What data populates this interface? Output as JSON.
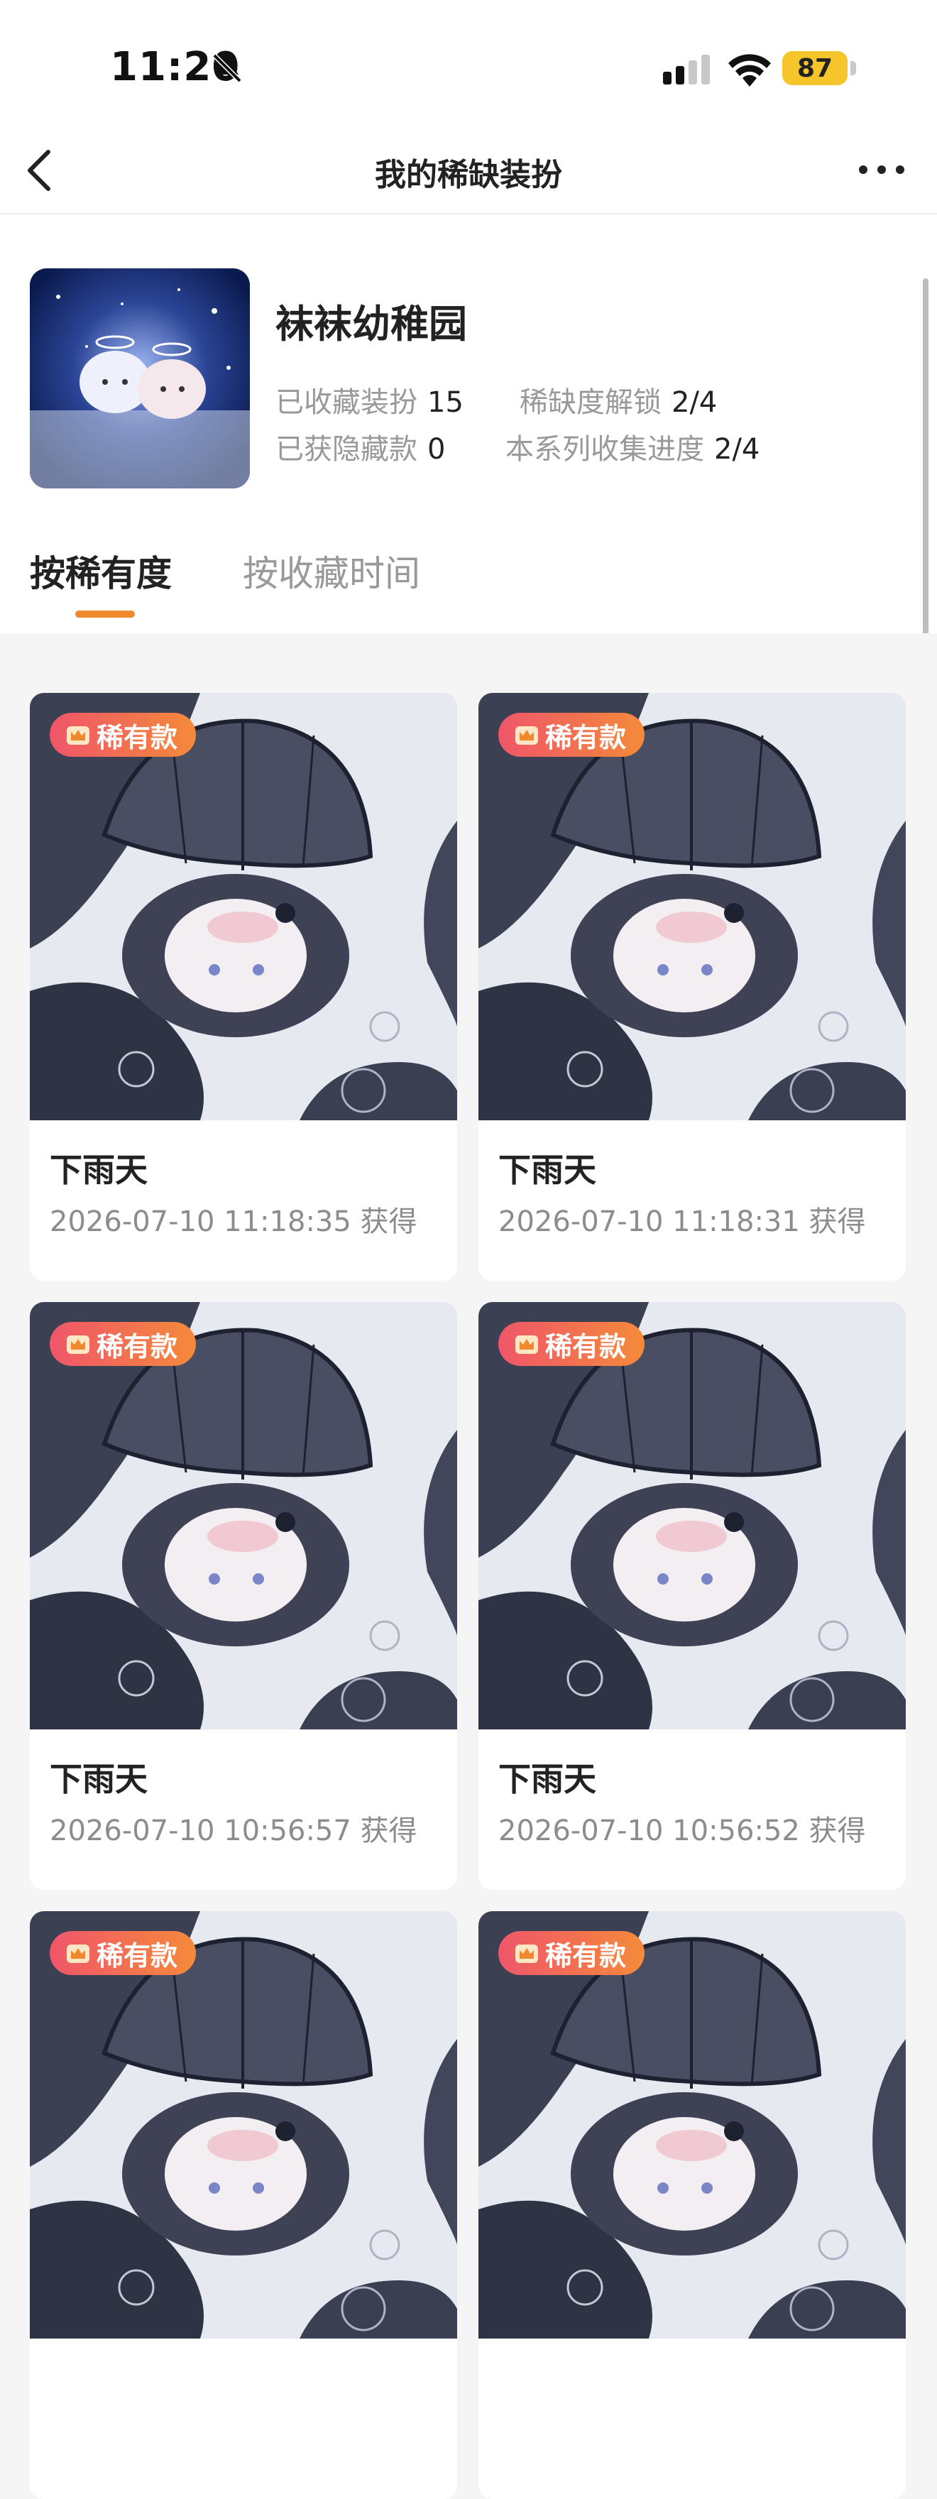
{
  "status_bar": {
    "time": "11:20",
    "battery": "87"
  },
  "nav": {
    "title": "我的稀缺装扮"
  },
  "series": {
    "title": "袜袜幼稚园",
    "stats": {
      "collected_label": "已收藏装扮",
      "collected_value": "15",
      "rarity_label": "稀缺度解锁",
      "rarity_value": "2/4",
      "hidden_label": "已获隐藏款",
      "hidden_value": "0",
      "progress_label": "本系列收集进度",
      "progress_value": "2/4"
    }
  },
  "tabs": [
    {
      "label": "按稀有度",
      "active": true
    },
    {
      "label": "按收藏时间",
      "active": false
    }
  ],
  "cards": [
    {
      "badge": "稀有款",
      "name": "下雨天",
      "time": "2026-07-10 11:18:35 获得"
    },
    {
      "badge": "稀有款",
      "name": "下雨天",
      "time": "2026-07-10 11:18:31 获得"
    },
    {
      "badge": "稀有款",
      "name": "下雨天",
      "time": "2026-07-10 10:56:57 获得"
    },
    {
      "badge": "稀有款",
      "name": "下雨天",
      "time": "2026-07-10 10:56:52 获得"
    },
    {
      "badge": "稀有款",
      "name": "",
      "time": ""
    },
    {
      "badge": "稀有款",
      "name": "",
      "time": ""
    }
  ],
  "colors": {
    "accent": "#f0882e",
    "badge_start": "#f0566a",
    "badge_end": "#f48a3a",
    "battery": "#f6c52c"
  }
}
